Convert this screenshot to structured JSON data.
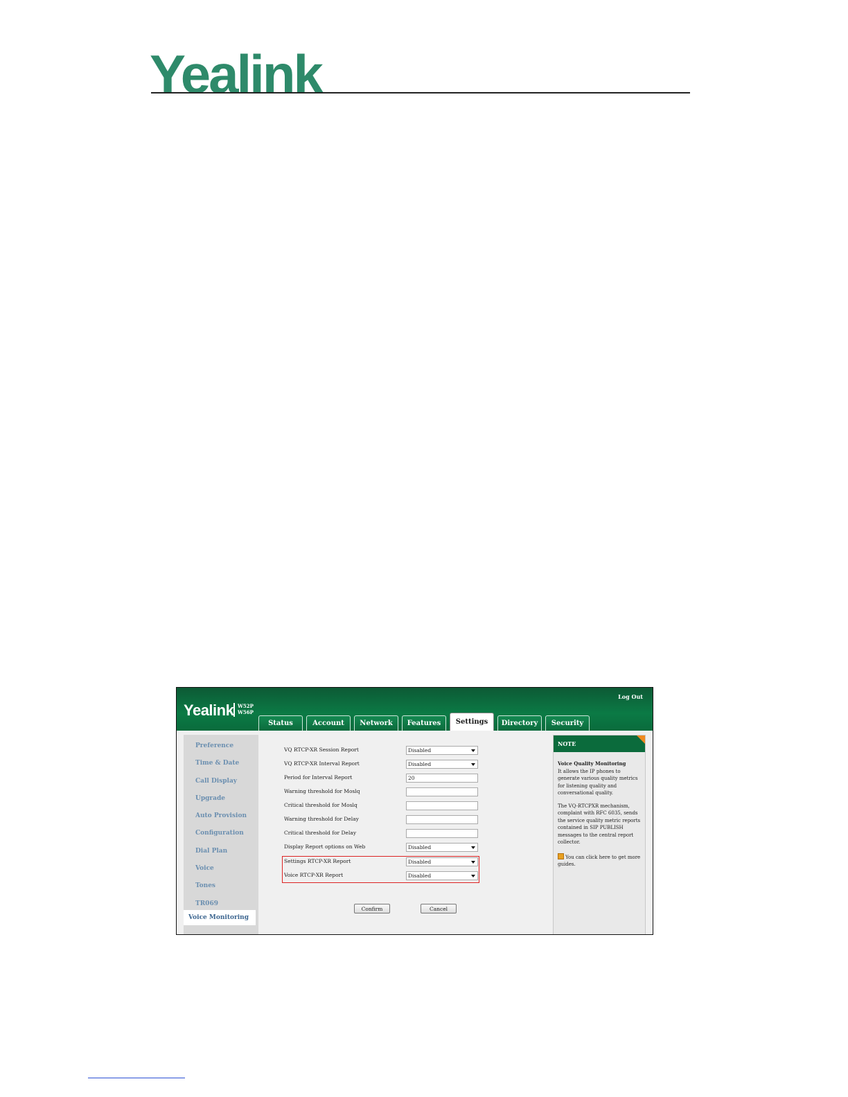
{
  "document": {
    "logo_text": "Yealink"
  },
  "app": {
    "logo_text": "Yealink",
    "models": [
      "W52P",
      "W56P"
    ],
    "logout_label": "Log Out",
    "tabs": [
      {
        "label": "Status",
        "active": false
      },
      {
        "label": "Account",
        "active": false
      },
      {
        "label": "Network",
        "active": false
      },
      {
        "label": "Features",
        "active": false
      },
      {
        "label": "Settings",
        "active": true
      },
      {
        "label": "Directory",
        "active": false
      },
      {
        "label": "Security",
        "active": false
      }
    ],
    "sidebar": [
      {
        "label": "Preference",
        "active": false
      },
      {
        "label": "Time & Date",
        "active": false
      },
      {
        "label": "Call Display",
        "active": false
      },
      {
        "label": "Upgrade",
        "active": false
      },
      {
        "label": "Auto Provision",
        "active": false
      },
      {
        "label": "Configuration",
        "active": false
      },
      {
        "label": "Dial Plan",
        "active": false
      },
      {
        "label": "Voice",
        "active": false
      },
      {
        "label": "Tones",
        "active": false
      },
      {
        "label": "TR069",
        "active": false
      },
      {
        "label": "Voice Monitoring",
        "active": true
      }
    ],
    "form": {
      "rows": [
        {
          "label": "VQ RTCP-XR Session Report",
          "value": "Disabled",
          "type": "select"
        },
        {
          "label": "VQ RTCP-XR Interval Report",
          "value": "Disabled",
          "type": "select"
        },
        {
          "label": "Period for Interval Report",
          "value": "20",
          "type": "text"
        },
        {
          "label": "Warning threshold for Moslq",
          "value": "",
          "type": "text"
        },
        {
          "label": "Critical threshold for Moslq",
          "value": "",
          "type": "text"
        },
        {
          "label": "Warning threshold for Delay",
          "value": "",
          "type": "text"
        },
        {
          "label": "Critical threshold for Delay",
          "value": "",
          "type": "text"
        },
        {
          "label": "Display Report options on Web",
          "value": "Disabled",
          "type": "select"
        },
        {
          "label": "Settings RTCP-XR Report",
          "value": "Disabled",
          "type": "select"
        },
        {
          "label": "Voice RTCP-XR Report",
          "value": "Disabled",
          "type": "select"
        }
      ],
      "confirm_label": "Confirm",
      "cancel_label": "Cancel"
    },
    "note": {
      "heading": "NOTE",
      "title": "Voice Quality Monitoring",
      "para1": "It allows the IP phones to generate various quality metrics for listening quality and conversational quality.",
      "para2": "The VQ-RTCPXR mechanism, complaint with RFC 6035, sends the service quality metric reports contained in SIP PUBLISH messages to the central report collector.",
      "tip": "You can click here to get more guides."
    },
    "colors": {
      "brand_green": "#0b6b3c",
      "highlight_red": "#dd2222",
      "note_corner": "#f08a20",
      "sidebar_text": "#6b8fb0"
    }
  }
}
